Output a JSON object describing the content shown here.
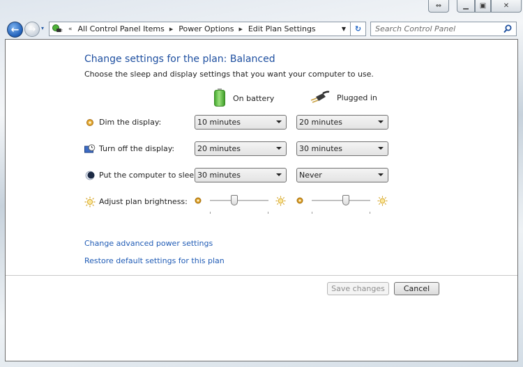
{
  "window": {
    "controls": {
      "snap_icon": "⇔",
      "minimize_icon": "▁",
      "maximize_icon": "▣",
      "close_icon": "✕"
    }
  },
  "navigation": {
    "back_icon": "←",
    "forward_icon": "→",
    "recent_icon": "▾",
    "address": {
      "overflow_icon": "«",
      "breadcrumbs": [
        "All Control Panel Items",
        "Power Options",
        "Edit Plan Settings"
      ],
      "separator_icon": "▶",
      "dropdown_icon": "▼"
    },
    "refresh_icon": "↻",
    "search": {
      "placeholder": "Search Control Panel",
      "value": ""
    }
  },
  "page": {
    "title": "Change settings for the plan: Balanced",
    "subtitle": "Choose the sleep and display settings that you want your computer to use.",
    "columns": {
      "battery": "On battery",
      "plugged": "Plugged in"
    },
    "settings": [
      {
        "label": "Dim the display:",
        "icon": "dim-display-icon",
        "battery": "10 minutes",
        "plugged": "20 minutes"
      },
      {
        "label": "Turn off the display:",
        "icon": "display-off-icon",
        "battery": "20 minutes",
        "plugged": "30 minutes"
      },
      {
        "label": "Put the computer to sleep:",
        "icon": "sleep-moon-icon",
        "battery": "30 minutes",
        "plugged": "Never"
      }
    ],
    "brightness": {
      "label": "Adjust plan brightness:",
      "battery_percent": 40,
      "plugged_percent": 60
    },
    "links": {
      "advanced": "Change advanced power settings",
      "restore": "Restore default settings for this plan"
    },
    "buttons": {
      "save": "Save changes",
      "cancel": "Cancel"
    }
  },
  "colors": {
    "heading": "#1e4fa0",
    "link": "#1f5bb5",
    "disabled_text": "#8e8e8e"
  }
}
